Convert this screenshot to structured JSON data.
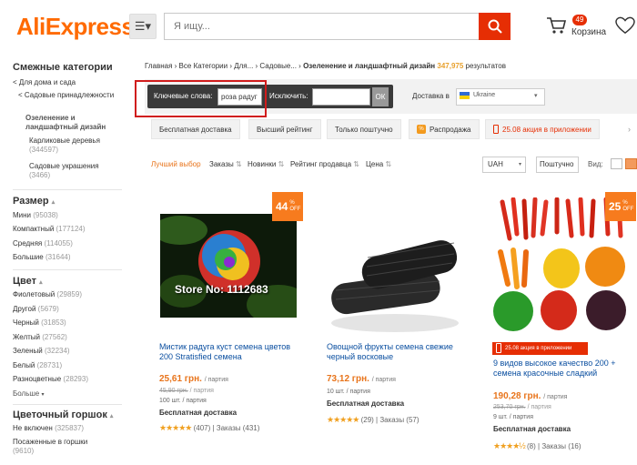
{
  "header": {
    "logo": "AliExpress",
    "logo_mark": "™",
    "search_placeholder": "Я ищу...",
    "cart_count": "49",
    "cart_label": "Корзина"
  },
  "sidebar": {
    "related_title": "Смежные категории",
    "related_back": "< Для дома и сада",
    "related_parent": "< Садовые принадлежности",
    "related_current": "Озеленение и ландшафтный дизайн",
    "related_sub": [
      {
        "label": "Карликовые деревья",
        "count": "(344597)"
      },
      {
        "label": "Садовые украшения",
        "count": "(3466)"
      }
    ],
    "size_title": "Размер",
    "sizes": [
      {
        "label": "Мини",
        "count": "(95038)"
      },
      {
        "label": "Компактный",
        "count": "(177124)"
      },
      {
        "label": "Средняя",
        "count": "(114055)"
      },
      {
        "label": "Большие",
        "count": "(31644)"
      }
    ],
    "color_title": "Цвет",
    "colors": [
      {
        "label": "Фиолетовый",
        "count": "(29859)"
      },
      {
        "label": "Другой",
        "count": "(5679)"
      },
      {
        "label": "Черный",
        "count": "(31853)"
      },
      {
        "label": "Желтый",
        "count": "(27562)"
      },
      {
        "label": "Зеленый",
        "count": "(32234)"
      },
      {
        "label": "Белый",
        "count": "(28731)"
      },
      {
        "label": "Разноцветные",
        "count": "(28293)"
      }
    ],
    "more_label": "Больше",
    "pot_title": "Цветочный горшок",
    "pots": [
      {
        "label": "Не включен",
        "count": "(325837)"
      },
      {
        "label": "Посаженные в горшки",
        "count": "(9610)"
      }
    ]
  },
  "breadcrumb": {
    "path": "Главная › Все Категории › Для... › Садовые... ›",
    "current": "Озеленение и ландшафтный дизайн",
    "count": "347,975",
    "results": "результатов"
  },
  "filter": {
    "keywords_label": "Ключевые слова:",
    "keywords_value": "роза радуг",
    "exclude_label": "Исключить:",
    "ok_label": "ОК",
    "ship_label": "Доставка в",
    "ship_country": "Ukraine"
  },
  "chips": [
    "Бесплатная доставка",
    "Высший рейтинг",
    "Только поштучно",
    "Распродажа",
    "25.08 акция в приложении"
  ],
  "sort": {
    "best": "Лучший выбор",
    "orders": "Заказы",
    "new": "Новинки",
    "seller_rating": "Рейтинг продавца",
    "price": "Цена",
    "currency": "UAH",
    "per": "Поштучно",
    "view_label": "Вид:"
  },
  "products": [
    {
      "title": "Мистик радуга куст семена цветов 200 Stratisfied семена",
      "price": "25,61 грн.",
      "unit": "/ партия",
      "old_price": "45,90 грн.",
      "old_unit": "/ партия",
      "min": "100 шт. / партия",
      "shipping": "Бесплатная доставка",
      "stars": "★★★★★",
      "rating": "(407) | Заказы (431)",
      "discount": "44",
      "watermark": "Store No: 1112683"
    },
    {
      "title": "Овощной фрукты семена свежие черный восковые",
      "price": "73,12 грн.",
      "unit": "/ партия",
      "min": "10 шт. / партия",
      "shipping": "Бесплатная доставка",
      "stars": "★★★★★",
      "rating": "(29) | Заказы (57)"
    },
    {
      "title": "9 видов высокое качество 200 + семена красочные сладкий",
      "promo": "25.08 акция в приложении",
      "price": "190,28 грн.",
      "unit": "/ партия",
      "old_price": "253,70 грн.",
      "old_unit": "/ партия",
      "min": "9 шт. / партия",
      "shipping": "Бесплатная доставка",
      "stars": "★★★★½",
      "rating": "(8) | Заказы (16)",
      "discount": "25"
    }
  ],
  "badge_off": "% OFF",
  "colors": {
    "brand": "#e62e04",
    "accent": "#ff6a00",
    "link": "#0b4fa0",
    "price": "#e8741b"
  }
}
